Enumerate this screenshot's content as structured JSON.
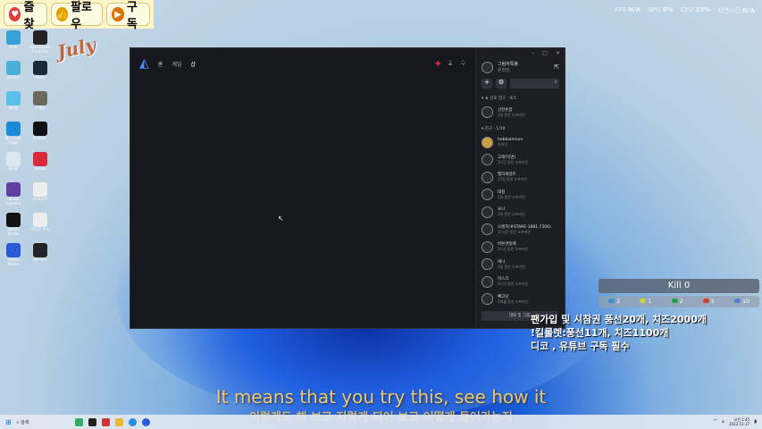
{
  "stream_buttons": [
    {
      "label": "즐찾",
      "icon": "heart-icon"
    },
    {
      "label": "팔로우",
      "icon": "thumbs-up-icon"
    },
    {
      "label": "구독",
      "icon": "play-icon"
    }
  ],
  "perf": {
    "fps_label": "FPS",
    "fps": "N/A",
    "gpu_label": "GPU",
    "gpu": "0%",
    "cpu_label": "CPU",
    "cpu": "23%",
    "time_label": "지연시간",
    "time": "N/A"
  },
  "desktop_icons": [
    "내 PC",
    "Epic Games Launcher",
    "네트워크",
    "Steam",
    "제어판",
    "PUBG",
    "Microsoft Edge",
    "Krunker",
    "휴지통",
    "Roblox",
    "Ubisoft Connect",
    "새 텍스트",
    "Roblox Studio",
    "텍스트 문서",
    "Roblox Player",
    "Kill Aim"
  ],
  "watermark": "July",
  "app": {
    "nav": [
      "홈",
      "게임",
      "샵"
    ],
    "profile": {
      "name": "그림자특봉",
      "status": "온라인"
    },
    "favorites_header": "▾ ★ 선호 친구 · 0/1",
    "friends_header": "▾ 친구 · 1/19",
    "favorites": [
      {
        "name": "선한손잡",
        "status": "1일 동안 오프라인"
      }
    ],
    "friends": [
      {
        "name": "hobbulemon",
        "status": "온라인"
      },
      {
        "name": "고래(익명)",
        "status": "3시간 동안 오프라인"
      },
      {
        "name": "멜리세랑트",
        "status": "17일 동안 오프라인"
      },
      {
        "name": "대형",
        "status": "3일 동안 오프라인"
      },
      {
        "name": "요니",
        "status": "3일 동안 오프라인"
      },
      {
        "name": "오렌지(#STAKE-1881.7306)",
        "status": "17시간 동안 오프라인"
      },
      {
        "name": "바본경정배",
        "status": "3시간 동안 오프라인"
      },
      {
        "name": "써니",
        "status": "3일 동안 오프라인"
      },
      {
        "name": "마스크",
        "status": "3시간 동안 오프라인"
      },
      {
        "name": "빼고냥",
        "status": "3개월 동안 오프라인"
      }
    ],
    "group_button": "대화 및 그룹"
  },
  "kill": {
    "title": "Kill 0",
    "counts": [
      {
        "v": "2",
        "color": "#3a8fd0"
      },
      {
        "v": "1",
        "color": "#c8d43a"
      },
      {
        "v": "2",
        "color": "#2a9a4a"
      },
      {
        "v": "5",
        "color": "#d83a3a"
      },
      {
        "v": "10",
        "color": "#5a7ad8"
      }
    ]
  },
  "notice": [
    "팬가입 및 시참권 풍선20개, 치즈2000개",
    "!킬룰렛:풍선11개, 치즈1100개",
    "디코 , 유튜브 구독 필수"
  ],
  "subtitles": {
    "en": "It means that you try this, see how it",
    "ko": "이렇게도 해 보고 저렇게 되어 보고 어떻게 들어가는지"
  },
  "taskbar": {
    "search": "검색",
    "time": "오전 1:45",
    "date": "2023-11-17"
  }
}
